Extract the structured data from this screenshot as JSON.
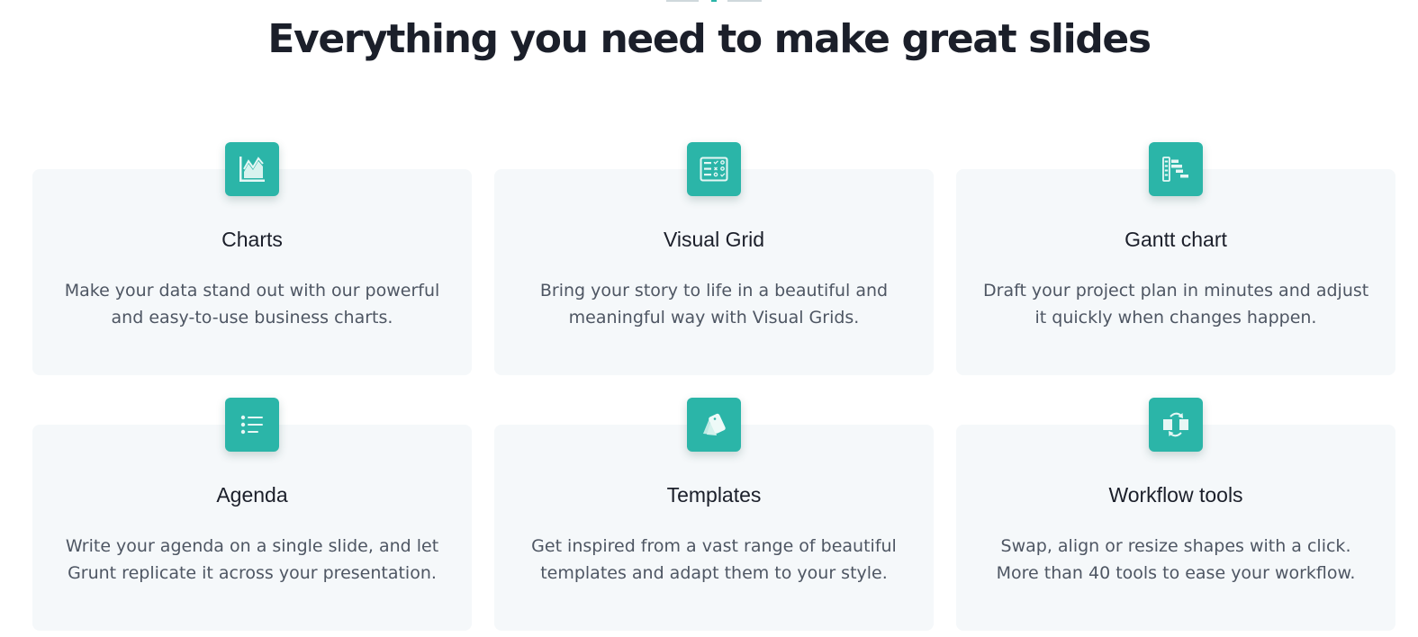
{
  "page": {
    "headline": "Everything you need to make great slides"
  },
  "colors": {
    "accent": "#2bb5a8",
    "card_background": "#f5f8fa",
    "heading_text": "#1b1f2a",
    "body_text": "#4e5663"
  },
  "features": [
    {
      "icon": "line-chart-icon",
      "title": "Charts",
      "description_lines": [
        "Make your data stand out with our powerful",
        "and easy-to-use business charts."
      ]
    },
    {
      "icon": "visual-grid-icon",
      "title": "Visual Grid",
      "description_lines": [
        "Bring your story to life in a beautiful and",
        "meaningful way with Visual Grids."
      ]
    },
    {
      "icon": "gantt-chart-icon",
      "title": "Gantt chart",
      "description_lines": [
        "Draft your project plan in minutes and adjust",
        "it quickly when changes happen."
      ]
    },
    {
      "icon": "agenda-list-icon",
      "title": "Agenda",
      "description_lines": [
        "Write your agenda on a single slide, and let",
        "Grunt replicate it across your presentation."
      ]
    },
    {
      "icon": "templates-icon",
      "title": "Templates",
      "description_lines": [
        "Get inspired from a vast range of beautiful",
        "templates and adapt them to your style."
      ]
    },
    {
      "icon": "workflow-swap-icon",
      "title": "Workflow tools",
      "description_lines": [
        "Swap, align or resize shapes with a click.",
        "More than 40 tools to ease your workflow."
      ]
    }
  ]
}
